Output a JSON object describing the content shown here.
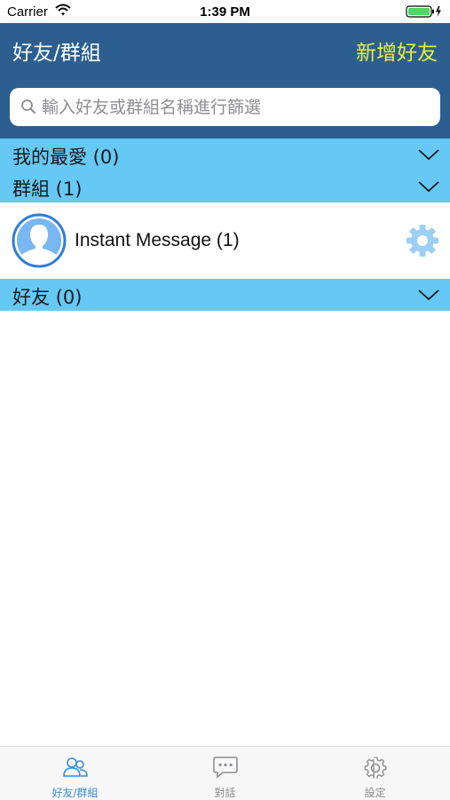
{
  "status_bar": {
    "carrier": "Carrier",
    "time": "1:39 PM"
  },
  "nav": {
    "title": "好友/群組",
    "action": "新增好友"
  },
  "search": {
    "placeholder": "輸入好友或群組名稱進行篩選",
    "value": ""
  },
  "sections": [
    {
      "label": "我的最愛 (0)"
    },
    {
      "label": "群組 (1)"
    },
    {
      "label": "好友 (0)"
    }
  ],
  "groups": [
    {
      "name": "Instant Message (1)"
    }
  ],
  "tabs": [
    {
      "label": "好友/群組",
      "icon": "friends-icon",
      "active": true
    },
    {
      "label": "對話",
      "icon": "chat-icon",
      "active": false
    },
    {
      "label": "設定",
      "icon": "settings-icon",
      "active": false
    }
  ],
  "colors": {
    "nav_background": "#2c5f90",
    "nav_action": "#e8ef3c",
    "section_header": "#66c8f5",
    "tab_active": "#3a8bd8",
    "tab_inactive": "#8e8e93",
    "gear": "#9ccff5"
  }
}
